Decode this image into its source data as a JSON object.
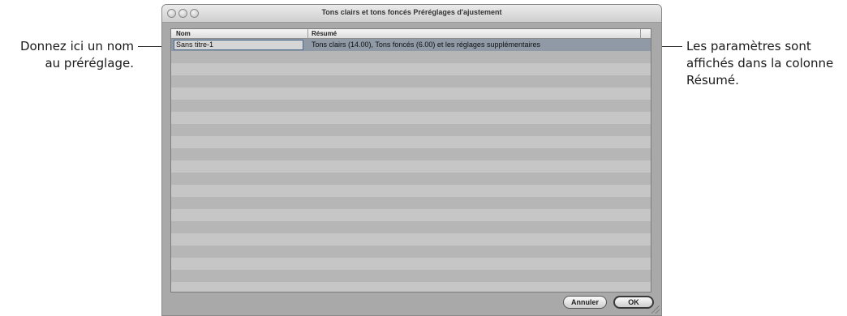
{
  "window": {
    "title": "Tons clairs et tons foncés Préréglages d'ajustement"
  },
  "table": {
    "columns": [
      "Nom",
      "Résumé"
    ],
    "rows": [
      {
        "name": "Sans titre-1",
        "summary": "Tons clairs (14.00), Tons foncés (6.00) et les réglages supplémentaires",
        "selected": true
      }
    ]
  },
  "buttons": {
    "cancel_label": "Annuler",
    "ok_label": "OK"
  },
  "callouts": {
    "left": [
      "Donnez ici un nom",
      "au préréglage."
    ],
    "right": [
      "Les paramètres sont",
      "affichés dans la colonne",
      "Résumé."
    ]
  },
  "colors": {
    "selection": "#8f9aa6",
    "window_bg": "#a9a9a9"
  }
}
